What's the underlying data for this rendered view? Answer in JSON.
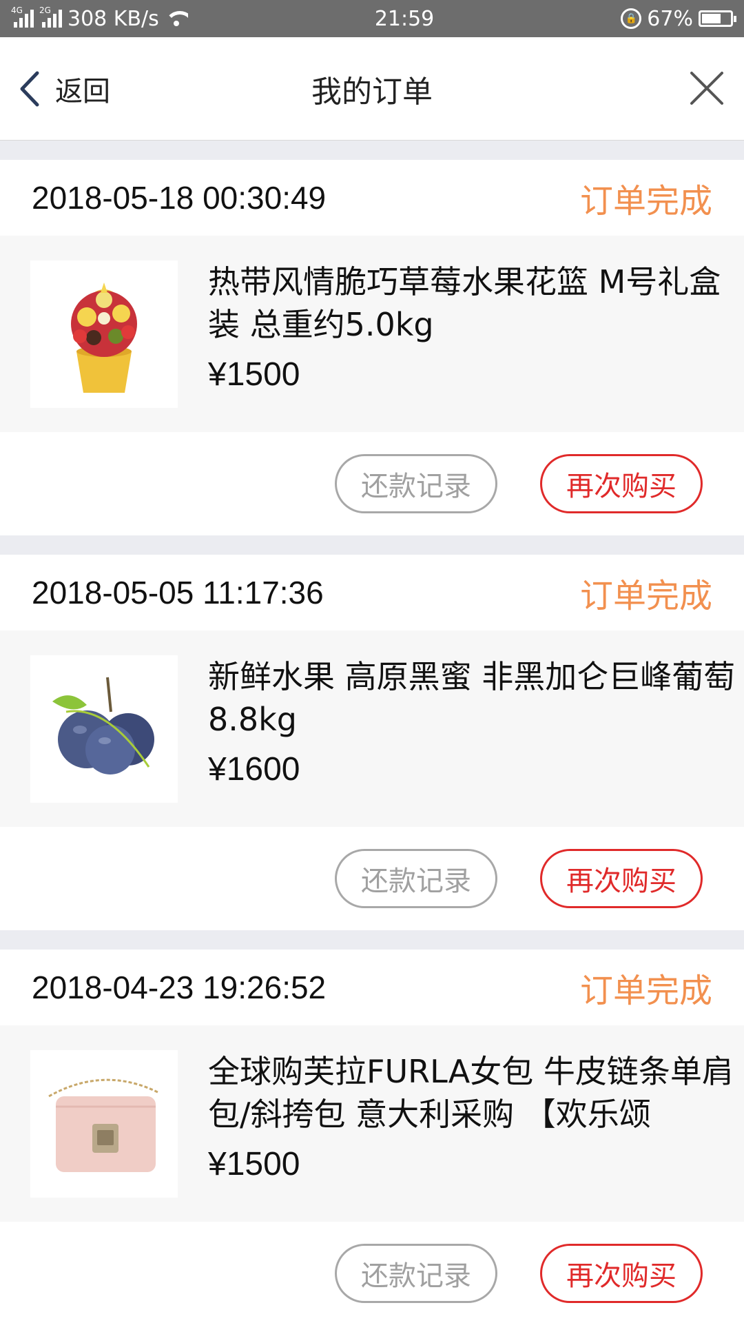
{
  "status_bar": {
    "network_1": "4G",
    "network_2": "2G",
    "speed": "308 KB/s",
    "time": "21:59",
    "battery": "67%",
    "battery_level": 0.67
  },
  "nav": {
    "back_label": "返回",
    "title": "我的订单"
  },
  "orders": [
    {
      "time": "2018-05-18 00:30:49",
      "status": "订单完成",
      "name": "热带风情脆巧草莓水果花篮 M号礼盒装 总重约5.0kg",
      "price": "¥1500",
      "image": "fruit-basket-image",
      "secondary_action": "还款记录",
      "primary_action": "再次购买"
    },
    {
      "time": "2018-05-05 11:17:36",
      "status": "订单完成",
      "name": "新鲜水果 高原黑蜜 非黑加仑巨峰葡萄 8.8kg",
      "price": "¥1600",
      "image": "grapes-image",
      "secondary_action": "还款记录",
      "primary_action": "再次购买"
    },
    {
      "time": "2018-04-23 19:26:52",
      "status": "订单完成",
      "name": "全球购芙拉FURLA女包 牛皮链条单肩包/斜挎包 意大利采购 【欢乐颂",
      "price": "¥1500",
      "image": "handbag-image",
      "secondary_action": "还款记录",
      "primary_action": "再次购买"
    }
  ],
  "colors": {
    "status_text": "#f2904f",
    "primary_button": "#e02a2a",
    "secondary_button": "#a8a8a8"
  }
}
